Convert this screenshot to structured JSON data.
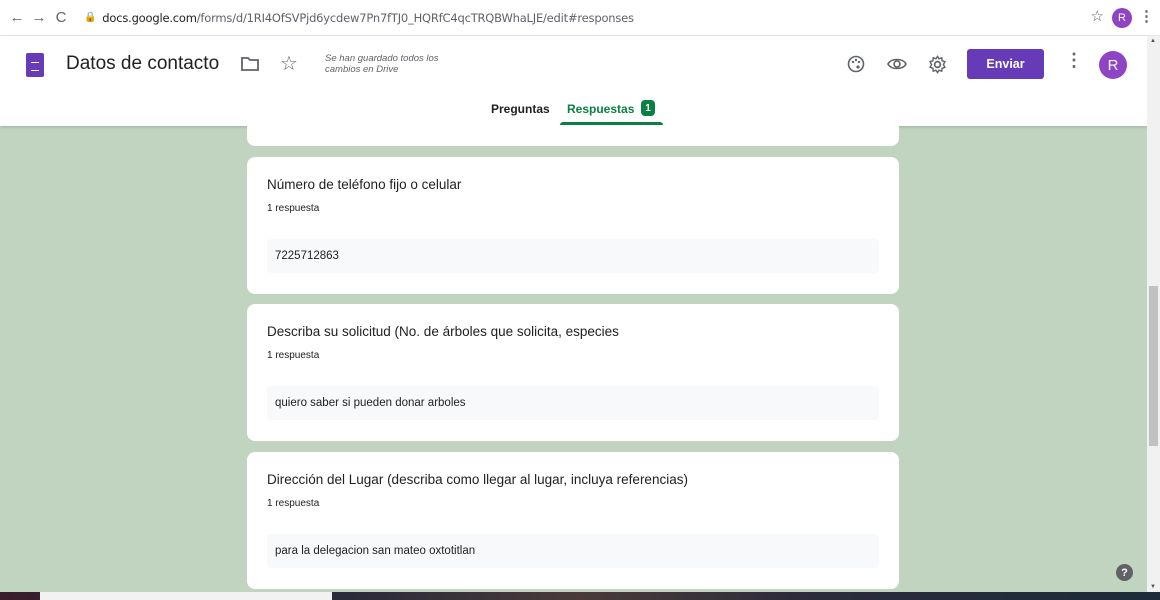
{
  "browser": {
    "url_host": "docs.google.com",
    "url_path": "/forms/d/1RI4OfSVPjd6ycdew7Pn7fTJ0_HQRfC4qcTRQBWhaLJE/edit#responses",
    "profile_initial": "R"
  },
  "header": {
    "title": "Datos de contacto",
    "saved_message": "Se han guardado todos los cambios en Drive",
    "send_label": "Enviar",
    "avatar_initial": "R",
    "brand_color": "#673ab7"
  },
  "tabs": {
    "questions_label": "Preguntas",
    "responses_label": "Respuestas",
    "responses_count": "1",
    "active_color": "#0b8043"
  },
  "questions": [
    {
      "title": "Número de teléfono fijo o celular",
      "count": "1 respuesta",
      "answer": "7225712863"
    },
    {
      "title": "Describa su solicitud (No. de árboles que solicita, especies",
      "count": "1 respuesta",
      "answer": "quiero saber si pueden donar arboles"
    },
    {
      "title": "Dirección del Lugar (describa como llegar al lugar, incluya referencias)",
      "count": "1 respuesta",
      "answer": "para la delegacion san mateo oxtotitlan"
    }
  ],
  "background_color": "#c0d4c0",
  "help_glyph": "?"
}
